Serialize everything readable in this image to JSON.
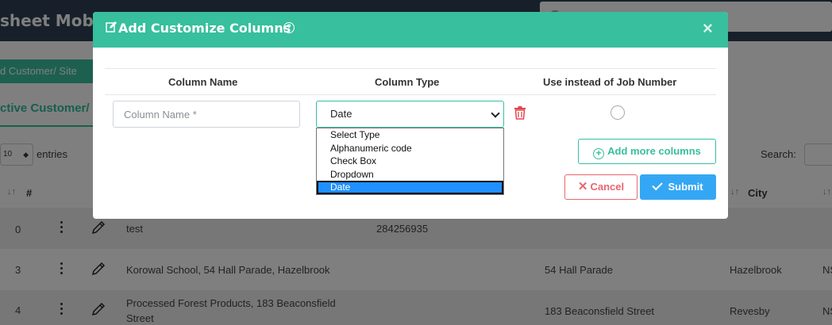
{
  "background": {
    "app_title": "sheet Mobile",
    "add_customer_button": "d Customer/ Site",
    "active_tab": "ctive Customer/",
    "entries_value": "10",
    "entries_label": "entries",
    "search_label": "Search:",
    "table": {
      "headers": {
        "index": "#",
        "city": "City"
      },
      "rows": [
        {
          "index": "0",
          "name": "test",
          "phone": "284256935",
          "street": "",
          "city": ""
        },
        {
          "index": "3",
          "name": "Korowal School, 54 Hall Parade, Hazelbrook",
          "phone": "",
          "street": "54 Hall Parade",
          "city": "Hazelbrook",
          "extra": "NS"
        },
        {
          "index": "4",
          "name": "Processed Forest Products, 183 Beaconsfield Street",
          "phone": "",
          "street": "183 Beaconsfield Street",
          "city": "Revesby",
          "extra": "NS"
        }
      ]
    }
  },
  "modal": {
    "title": "Add Customize Columns",
    "columns": {
      "name": "Column Name",
      "type": "Column Type",
      "instead": "Use instead of Job Number"
    },
    "row": {
      "name_placeholder": "Column Name *",
      "type_value": "Date"
    },
    "type_options": [
      "Select Type",
      "Alphanumeric code",
      "Check Box",
      "Dropdown",
      "Date"
    ],
    "add_more_label": "Add more columns",
    "cancel_label": "Cancel",
    "submit_label": "Submit"
  },
  "colors": {
    "header_teal": "#37bf9e",
    "submit_blue": "#34a7f4",
    "cancel_red": "#e8676f",
    "selected_option": "#1e90ff"
  },
  "icons": [
    "search-icon",
    "edit-icon",
    "help-icon",
    "close-icon",
    "trash-icon",
    "plus-circle-icon",
    "x-icon",
    "check-icon",
    "kebab-icon",
    "pencil-icon",
    "sort-icon",
    "chevron-down-icon"
  ]
}
